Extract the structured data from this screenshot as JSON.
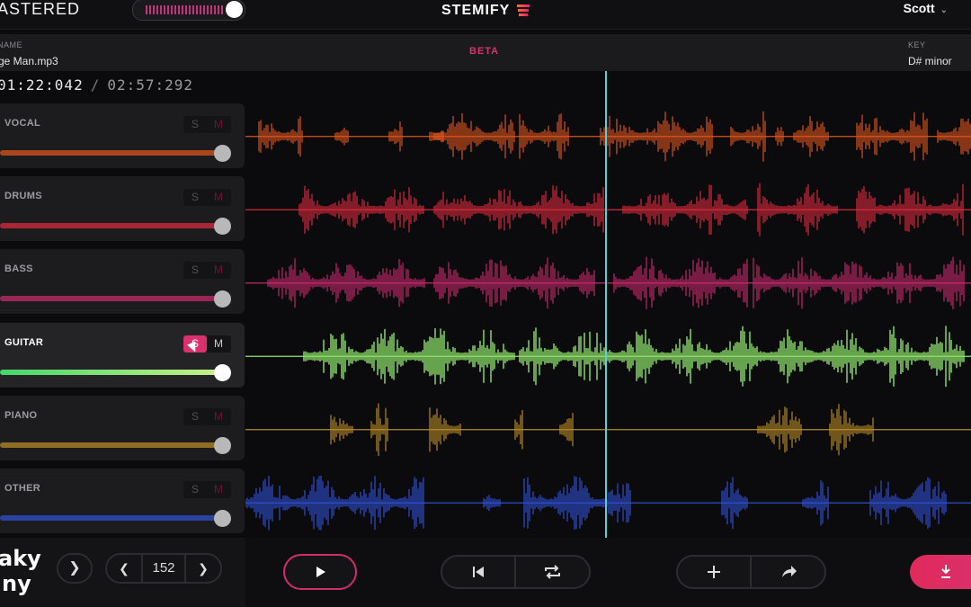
{
  "app": {
    "mode_label": "ASTERED",
    "logo_text": "STEMIFY",
    "user_name": "Scott",
    "user_chevron_icon": "chevron-down-icon"
  },
  "info": {
    "name_label": "NAME",
    "file_name": "ge Man.mp3",
    "beta_label": "BETA",
    "key_label": "KEY",
    "key_value": "D# minor"
  },
  "time": {
    "current": "01:22:042",
    "separator": "/",
    "duration": "02:57:292"
  },
  "tracks": [
    {
      "name": "VOCAL",
      "solo": "S",
      "mute": "M",
      "color": "#d9541e",
      "volume": 1.0,
      "solo_on": false
    },
    {
      "name": "DRUMS",
      "solo": "S",
      "mute": "M",
      "color": "#d72a3d",
      "volume": 1.0,
      "solo_on": false
    },
    {
      "name": "BASS",
      "solo": "S",
      "mute": "M",
      "color": "#c42a6b",
      "volume": 1.0,
      "solo_on": false
    },
    {
      "name": "GUITAR",
      "solo": "S",
      "mute": "M",
      "color": "#8fe46a",
      "volume": 1.0,
      "solo_on": true
    },
    {
      "name": "PIANO",
      "solo": "S",
      "mute": "M",
      "color": "#b58a27",
      "volume": 1.0,
      "solo_on": false
    },
    {
      "name": "OTHER",
      "solo": "S",
      "mute": "M",
      "color": "#2f4fcf",
      "volume": 1.0,
      "solo_on": false
    }
  ],
  "playhead_fraction": 0.463,
  "transport": {
    "bpm": "152",
    "prev_icon": "chevron-left-icon",
    "next_icon": "chevron-right-icon",
    "play_icon": "play-icon",
    "skip_back_icon": "skip-back-icon",
    "loop_icon": "loop-icon",
    "add_icon": "plus-icon",
    "share_icon": "share-icon",
    "download_icon": "download-icon"
  },
  "colors": {
    "accent": "#d8316d",
    "playhead": "#5ecfd6",
    "background": "#0b0b0d"
  }
}
